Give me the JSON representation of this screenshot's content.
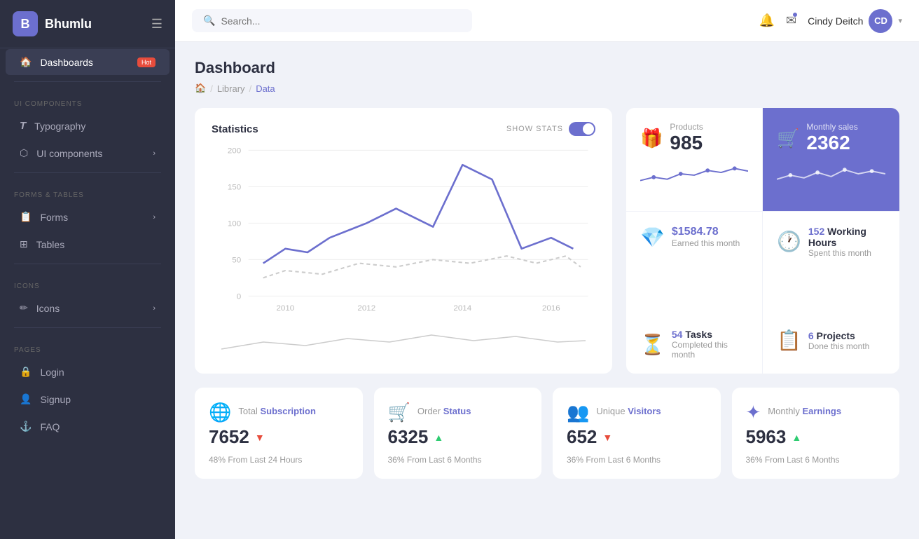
{
  "app": {
    "logo_letter": "B",
    "logo_name": "Bhumlu"
  },
  "sidebar": {
    "sections": [
      {
        "label": "",
        "items": [
          {
            "icon": "🏠",
            "label": "Dashboards",
            "badge": "Hot",
            "active": true
          }
        ]
      },
      {
        "label": "UI Components",
        "items": [
          {
            "icon": "T",
            "label": "Typography",
            "hasChevron": false
          },
          {
            "icon": "⬡",
            "label": "UI components",
            "hasChevron": true
          }
        ]
      },
      {
        "label": "Forms & Tables",
        "items": [
          {
            "icon": "📋",
            "label": "Forms",
            "hasChevron": true
          },
          {
            "icon": "⊞",
            "label": "Tables",
            "hasChevron": false
          }
        ]
      },
      {
        "label": "Icons",
        "items": [
          {
            "icon": "✏",
            "label": "Icons",
            "hasChevron": true
          }
        ]
      },
      {
        "label": "Pages",
        "items": [
          {
            "icon": "🔒",
            "label": "Login"
          },
          {
            "icon": "👤",
            "label": "Signup"
          },
          {
            "icon": "⚓",
            "label": "FAQ"
          }
        ]
      }
    ]
  },
  "header": {
    "search_placeholder": "Search...",
    "user_name": "Cindy Deitch",
    "user_initials": "CD"
  },
  "breadcrumb": {
    "items": [
      "🏠",
      "Library",
      "Data"
    ]
  },
  "page": {
    "title": "Dashboard"
  },
  "stats_card": {
    "title": "Statistics",
    "show_stats_label": "SHOW STATS",
    "y_labels": [
      "200",
      "150",
      "100",
      "50",
      "0"
    ],
    "x_labels": [
      "2010",
      "2012",
      "2014",
      "2016"
    ]
  },
  "products_card": {
    "label": "Products",
    "value": "985"
  },
  "monthly_card": {
    "label": "Monthly sales",
    "value": "2362"
  },
  "right_stats": [
    {
      "value": "$1584.78",
      "label": "Earned this month",
      "icon": "💎"
    },
    {
      "value": "152",
      "extra": "Working Hours",
      "label": "Spent this month",
      "icon": "🕐"
    },
    {
      "value": "54",
      "extra": "Tasks",
      "label": "Completed this month",
      "icon": "⏳"
    },
    {
      "value": "6",
      "extra": "Projects",
      "label": "Done this month",
      "icon": "📋"
    }
  ],
  "bottom_cards": [
    {
      "label_static": "Total",
      "label_highlight": "Subscription",
      "value": "7652",
      "arrow": "down",
      "footer": "48% From Last 24 Hours",
      "icon": "🌐"
    },
    {
      "label_static": "Order",
      "label_highlight": "Status",
      "value": "6325",
      "arrow": "up",
      "footer": "36% From Last 6 Months",
      "icon": "🛒"
    },
    {
      "label_static": "Unique",
      "label_highlight": "Visitors",
      "value": "652",
      "arrow": "down",
      "footer": "36% From Last 6 Months",
      "icon": "👥"
    },
    {
      "label_static": "Monthly",
      "label_highlight": "Earnings",
      "value": "5963",
      "arrow": "up",
      "footer": "36% From Last 6 Months",
      "icon": "✦"
    }
  ]
}
